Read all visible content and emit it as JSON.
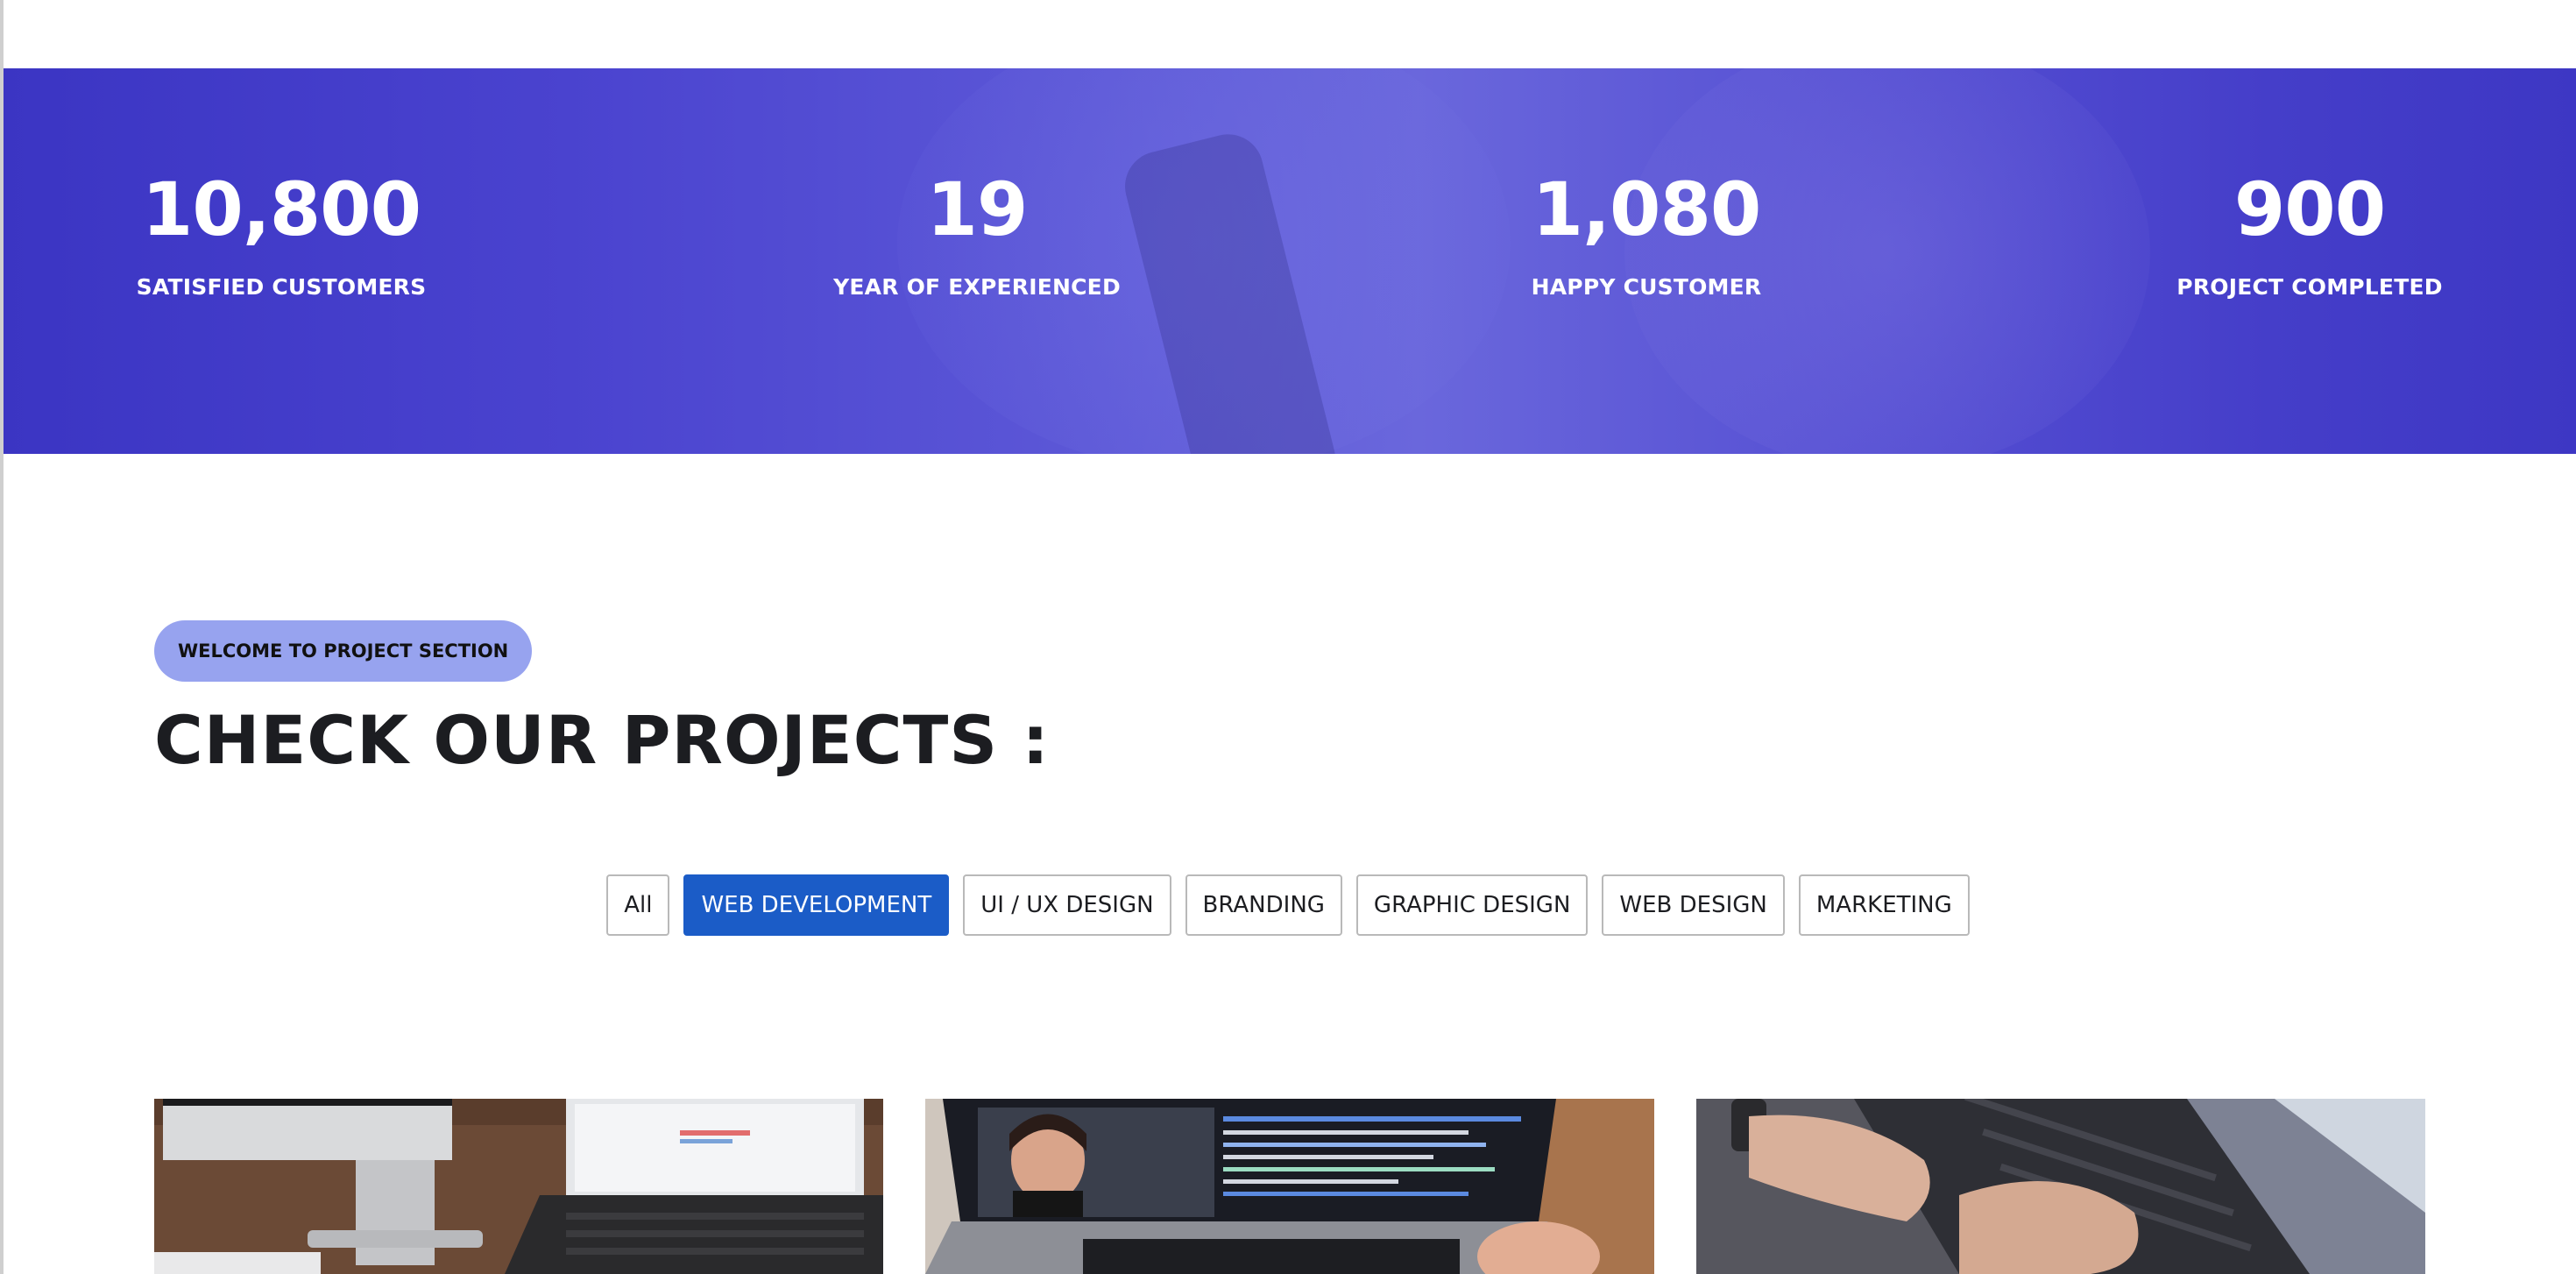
{
  "stats": [
    {
      "number": "10,800",
      "label": "SATISFIED CUSTOMERS"
    },
    {
      "number": "19",
      "label": "YEAR OF EXPERIENCED"
    },
    {
      "number": "1,080",
      "label": "HAPPY CUSTOMER"
    },
    {
      "number": "900",
      "label": "PROJECT COMPLETED"
    }
  ],
  "projects": {
    "eyebrow": "WELCOME TO PROJECT SECTION",
    "title": "CHECK OUR PROJECTS :",
    "filters": [
      {
        "label": "All",
        "active": false
      },
      {
        "label": "WEB DEVELOPMENT",
        "active": true
      },
      {
        "label": "UI / UX DESIGN",
        "active": false
      },
      {
        "label": "BRANDING",
        "active": false
      },
      {
        "label": "GRAPHIC DESIGN",
        "active": false
      },
      {
        "label": "WEB DESIGN",
        "active": false
      },
      {
        "label": "MARKETING",
        "active": false
      }
    ],
    "cards": [
      {
        "subject": "desk-with-imac-and-macbook"
      },
      {
        "subject": "person-on-video-call-with-code-on-laptop"
      },
      {
        "subject": "hands-typing-on-laptop"
      }
    ]
  },
  "colors": {
    "banner": "#4a43cf",
    "eyebrow_bg": "#97a3ef",
    "active_filter": "#1b5cc7"
  }
}
